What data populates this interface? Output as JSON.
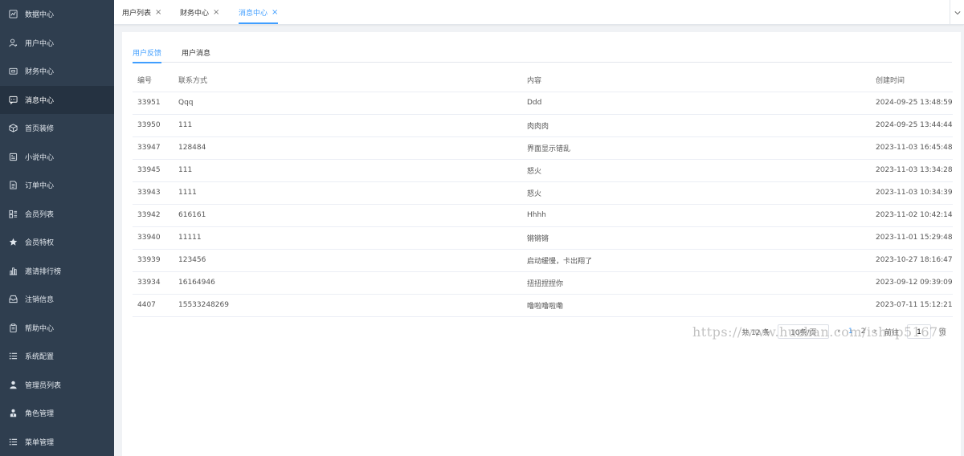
{
  "sidebar": {
    "items": [
      {
        "label": "数据中心",
        "icon": "chart-icon"
      },
      {
        "label": "用户中心",
        "icon": "user-icon"
      },
      {
        "label": "财务中心",
        "icon": "wallet-icon"
      },
      {
        "label": "消息中心",
        "icon": "message-icon",
        "active": true
      },
      {
        "label": "首页装修",
        "icon": "box-icon"
      },
      {
        "label": "小说中心",
        "icon": "book-icon"
      },
      {
        "label": "订单中心",
        "icon": "document-icon"
      },
      {
        "label": "会员列表",
        "icon": "list-icon"
      },
      {
        "label": "会员特权",
        "icon": "star-icon"
      },
      {
        "label": "邀请排行榜",
        "icon": "bar-chart-icon"
      },
      {
        "label": "注销信息",
        "icon": "inbox-icon"
      },
      {
        "label": "帮助中心",
        "icon": "clipboard-icon"
      },
      {
        "label": "系统配置",
        "icon": "menu-list-icon"
      },
      {
        "label": "管理员列表",
        "icon": "person-icon"
      },
      {
        "label": "角色管理",
        "icon": "role-icon"
      },
      {
        "label": "菜单管理",
        "icon": "menu-list-icon"
      }
    ]
  },
  "top_tabs": [
    {
      "label": "用户列表"
    },
    {
      "label": "财务中心"
    },
    {
      "label": "消息中心",
      "active": true
    }
  ],
  "close_glyph": "×",
  "sub_tabs": [
    {
      "label": "用户反馈",
      "active": true
    },
    {
      "label": "用户消息"
    }
  ],
  "table": {
    "headers": [
      "编号",
      "联系方式",
      "内容",
      "创建时间"
    ],
    "rows": [
      [
        "33951",
        "Qqq",
        "Ddd",
        "2024-09-25 13:48:59"
      ],
      [
        "33950",
        "111",
        "肉肉肉",
        "2024-09-25 13:44:44"
      ],
      [
        "33947",
        "128484",
        "界面显示错乱",
        "2023-11-03 16:45:48"
      ],
      [
        "33945",
        "111",
        "怒火",
        "2023-11-03 13:34:28"
      ],
      [
        "33943",
        "1111",
        "怒火",
        "2023-11-03 10:34:39"
      ],
      [
        "33942",
        "616161",
        "Hhhh",
        "2023-11-02 10:42:14"
      ],
      [
        "33940",
        "11111",
        "锵锵锵",
        "2023-11-01 15:29:48"
      ],
      [
        "33939",
        "123456",
        "启动缓慢，卡出翔了",
        "2023-10-27 18:16:47"
      ],
      [
        "33934",
        "16164946",
        "扭扭捏捏你",
        "2023-09-12 09:39:09"
      ],
      [
        "4407",
        "15533248269",
        "噜啦噜啦嘞",
        "2023-07-11 15:12:21"
      ]
    ]
  },
  "pager": {
    "total": "共 12 条",
    "page_size": "10条/页",
    "prev": "‹",
    "page_current": "1",
    "page_next": "2",
    "next": "›",
    "goto": "前往",
    "goto_value": "1",
    "page_unit": "页"
  },
  "watermark": "https://www.huzhan.com/ishop51679",
  "colors": {
    "sidebar_bg": "#2f3e4f",
    "accent": "#409eff"
  }
}
